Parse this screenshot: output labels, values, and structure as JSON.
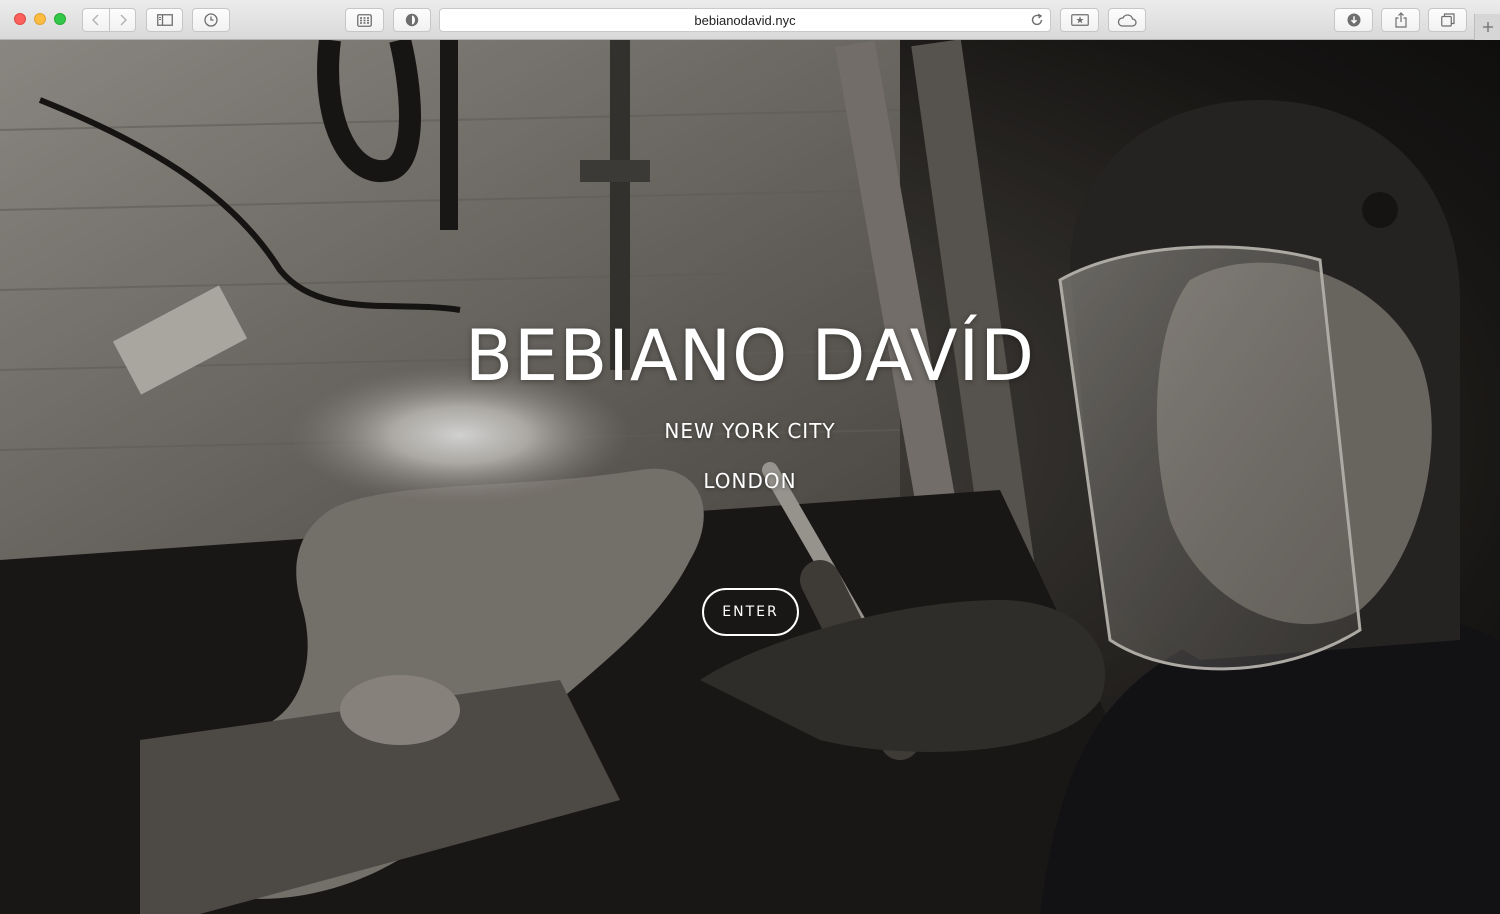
{
  "browser": {
    "url": "bebianodavid.nyc",
    "toolbar_icons": [
      "back-icon",
      "forward-icon",
      "sidebar-icon",
      "history-icon",
      "grid-icon",
      "privacy-icon",
      "reload-icon",
      "bookmark-star-icon",
      "cloud-icon",
      "download-icon",
      "share-icon",
      "tabs-icon",
      "plus-icon"
    ]
  },
  "hero": {
    "title": "BEBIANO DAVÍD",
    "city_1": "NEW YORK CITY",
    "city_2": "LONDON",
    "enter_label": "ENTER"
  },
  "colors": {
    "overlay_text": "#ffffff",
    "traffic_red": "#fc605c",
    "traffic_yellow": "#fdbc40",
    "traffic_green": "#34c84a"
  }
}
